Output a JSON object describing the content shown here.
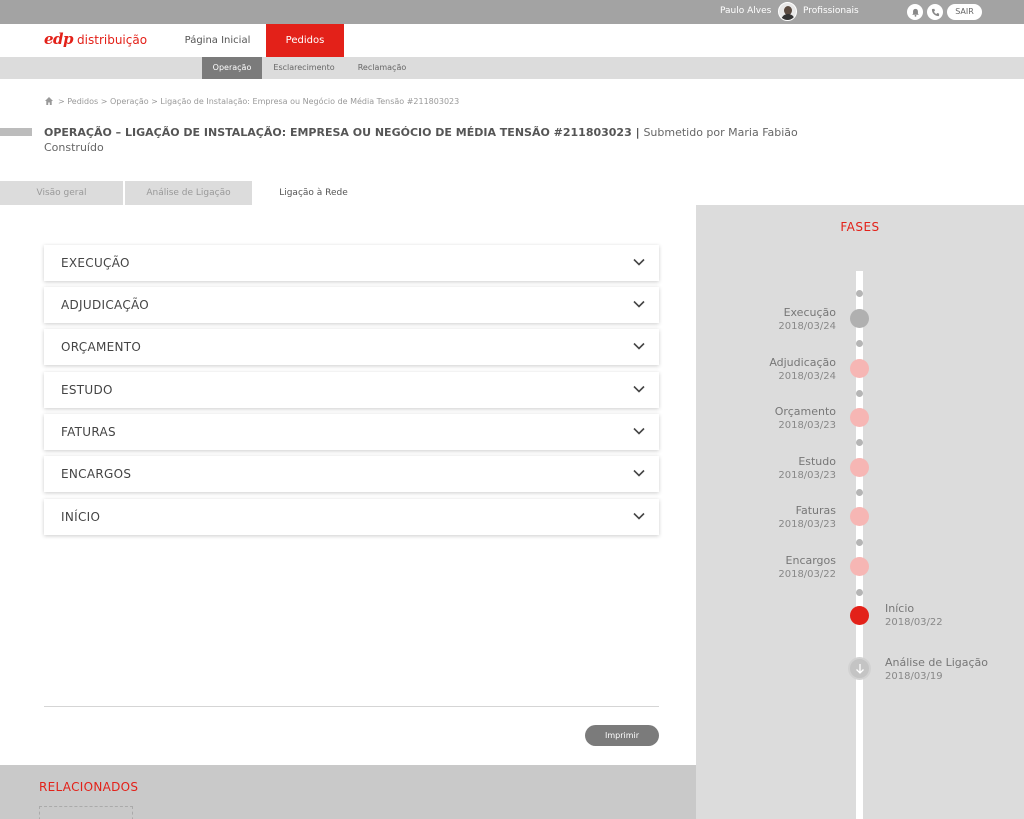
{
  "userbar": {
    "user_name": "Paulo Alves",
    "profile": "Profissionais",
    "logout": "SAIR"
  },
  "nav": {
    "logo_mark": "edp",
    "logo_text": "distribuição",
    "items": [
      {
        "label": "Página Inicial"
      },
      {
        "label": "Pedidos"
      }
    ]
  },
  "subnav": {
    "items": [
      {
        "label": "Operação"
      },
      {
        "label": "Esclarecimento"
      },
      {
        "label": "Reclamação"
      }
    ]
  },
  "breadcrumb": {
    "text": "> Pedidos > Operação > Ligação de Instalação: Empresa ou Negócio de Média Tensão #211803023"
  },
  "page": {
    "title": "OPERAÇÃO – LIGAÇÃO DE INSTALAÇÃO: EMPRESA OU NEGÓCIO DE MÉDIA TENSÃO #211803023 |",
    "submitted": "Submetido por Maria Fabião",
    "status": "Construído"
  },
  "tabs": [
    {
      "label": "Visão geral"
    },
    {
      "label": "Análise de Ligação"
    },
    {
      "label": "Ligação à Rede"
    }
  ],
  "accordion": [
    {
      "label": "EXECUÇÃO"
    },
    {
      "label": "ADJUDICAÇÃO"
    },
    {
      "label": "ORÇAMENTO"
    },
    {
      "label": "ESTUDO"
    },
    {
      "label": "FATURAS"
    },
    {
      "label": "ENCARGOS"
    },
    {
      "label": "INÍCIO"
    }
  ],
  "print_label": "Imprimir",
  "related": {
    "title": "RELACIONADOS"
  },
  "phases": {
    "title": "FASES",
    "items": [
      {
        "name": "Execução",
        "date": "2018/03/24",
        "state": "pending"
      },
      {
        "name": "Adjudicação",
        "date": "2018/03/24",
        "state": "upcoming"
      },
      {
        "name": "Orçamento",
        "date": "2018/03/23",
        "state": "upcoming"
      },
      {
        "name": "Estudo",
        "date": "2018/03/23",
        "state": "upcoming"
      },
      {
        "name": "Faturas",
        "date": "2018/03/23",
        "state": "upcoming"
      },
      {
        "name": "Encargos",
        "date": "2018/03/22",
        "state": "upcoming"
      },
      {
        "name": "Início",
        "date": "2018/03/22",
        "state": "current"
      },
      {
        "name": "Análise de Ligação",
        "date": "2018/03/19",
        "state": "done"
      }
    ]
  },
  "colors": {
    "brand_red": "#e32119",
    "upcoming_pink": "#f6b6b4",
    "pending_gray": "#b0b0b0"
  }
}
